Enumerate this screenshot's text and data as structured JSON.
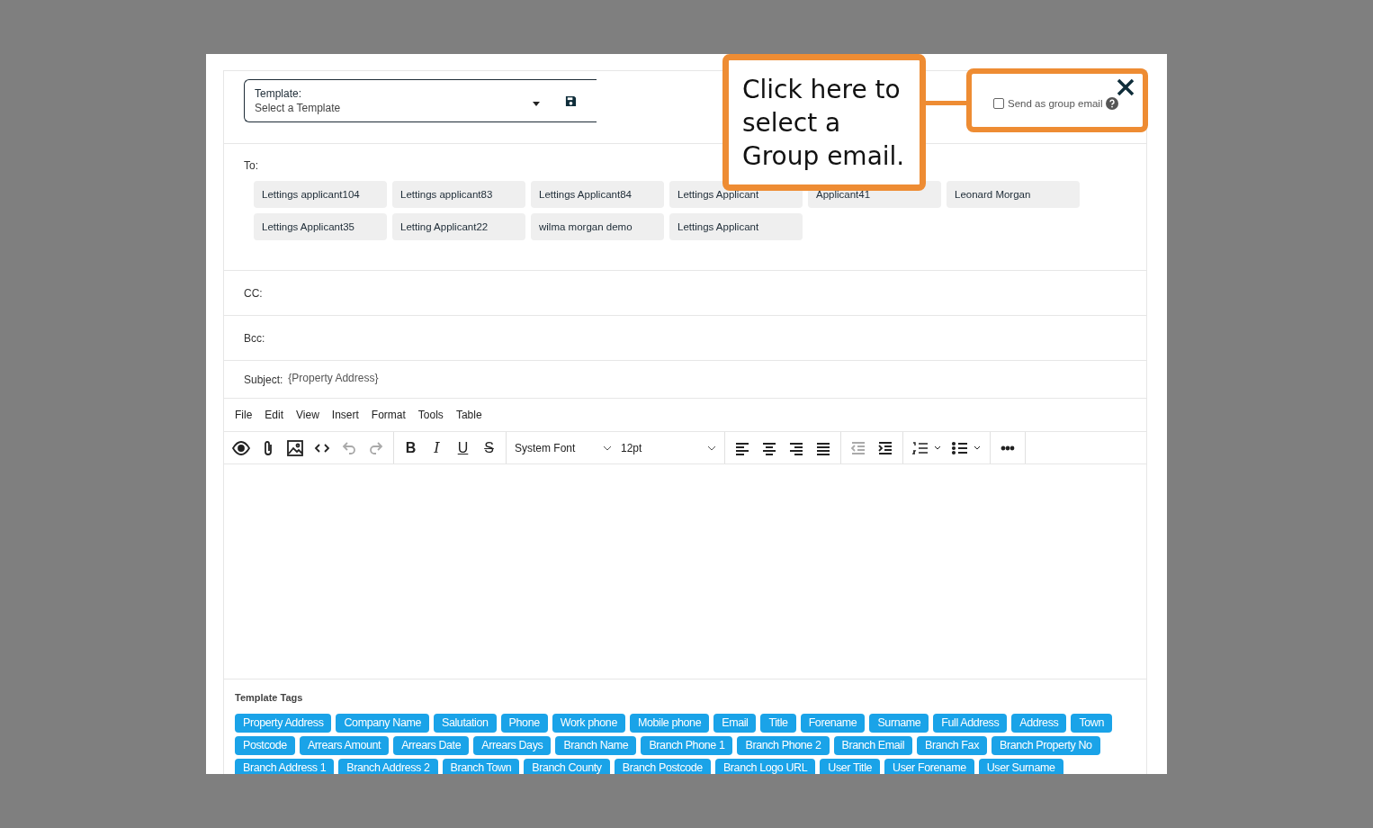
{
  "template": {
    "label": "Template:",
    "placeholder": "Select a Template"
  },
  "group_email": {
    "label": "Send as group email",
    "checked": false
  },
  "callout": {
    "text": "Click here to select a Group email."
  },
  "to": {
    "label": "To:",
    "recipients": [
      [
        "Lettings applicant104",
        "Lettings applicant83",
        "Lettings Applicant84",
        "Lettings Applicant",
        "Applicant41",
        "Leonard Morgan"
      ],
      [
        "Lettings Applicant35",
        "Letting Applicant22",
        "wilma morgan demo",
        "Lettings Applicant"
      ]
    ]
  },
  "cc": {
    "label": "CC:"
  },
  "bcc": {
    "label": "Bcc:"
  },
  "subject": {
    "label": "Subject:",
    "value": "{Property Address}"
  },
  "menu": [
    "File",
    "Edit",
    "View",
    "Insert",
    "Format",
    "Tools",
    "Table"
  ],
  "toolbar": {
    "groups": [
      [
        {
          "kind": "preview",
          "disabled": false
        },
        {
          "kind": "attach",
          "disabled": false
        },
        {
          "kind": "image",
          "disabled": false
        },
        {
          "kind": "code",
          "disabled": false
        },
        {
          "kind": "undo",
          "disabled": true
        },
        {
          "kind": "redo",
          "disabled": true
        }
      ],
      [
        {
          "kind": "bold",
          "glyph": "B",
          "disabled": false
        },
        {
          "kind": "italic",
          "glyph": "I",
          "disabled": false
        },
        {
          "kind": "underline",
          "glyph": "U",
          "disabled": false
        },
        {
          "kind": "strike",
          "glyph": "S",
          "disabled": false
        }
      ],
      [
        {
          "kind": "select",
          "value": "System Font",
          "disabled": false
        },
        {
          "kind": "select",
          "value": "12pt",
          "disabled": false
        }
      ],
      [
        {
          "kind": "align-left",
          "disabled": false
        },
        {
          "kind": "align-center",
          "disabled": false
        },
        {
          "kind": "align-right",
          "disabled": false
        },
        {
          "kind": "justify",
          "disabled": false
        }
      ],
      [
        {
          "kind": "outdent",
          "disabled": true
        },
        {
          "kind": "indent",
          "disabled": false
        }
      ],
      [
        {
          "kind": "numlist",
          "disabled": false
        },
        {
          "kind": "bullist",
          "disabled": false
        }
      ],
      [
        {
          "kind": "more",
          "disabled": false
        }
      ]
    ]
  },
  "template_tags": {
    "title": "Template Tags",
    "tags": [
      "Property Address",
      "Company Name",
      "Salutation",
      "Phone",
      "Work phone",
      "Mobile phone",
      "Email",
      "Title",
      "Forename",
      "Surname",
      "Full Address",
      "Address",
      "Town",
      "Postcode",
      "Arrears Amount",
      "Arrears Date",
      "Arrears Days",
      "Branch Name",
      "Branch Phone 1",
      "Branch Phone 2",
      "Branch Email",
      "Branch Fax",
      "Branch Property No",
      "Branch Address 1",
      "Branch Address 2",
      "Branch Town",
      "Branch County",
      "Branch Postcode",
      "Branch Logo URL",
      "User Title",
      "User Forename",
      "User Surname"
    ]
  }
}
